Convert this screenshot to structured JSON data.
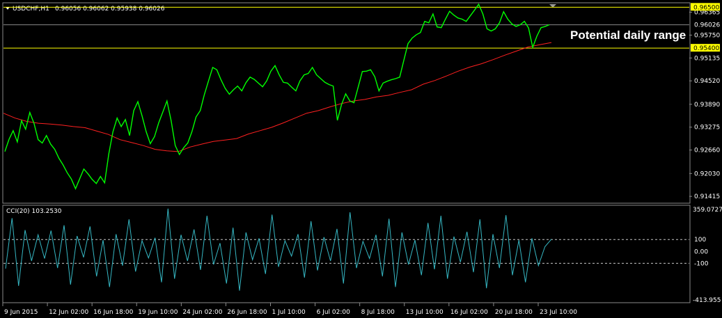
{
  "header": {
    "symbol": "USDCHF,H1",
    "ohlc": "0.96056 0.96062 0.95938 0.96026"
  },
  "annotation": "Potential daily range",
  "indicator": {
    "title": "CCI(20) 103.2530",
    "max_label": "359.0727",
    "min_label": "-413.955",
    "levels": [
      "100",
      "0.00",
      "-100"
    ]
  },
  "colors": {
    "background": "#000000",
    "price": "#00ff00",
    "moving_average": "#ff2020",
    "cci": "#36b8c4",
    "range_tag": "#ffff00"
  },
  "chart_data": [
    {
      "type": "line",
      "series": [
        {
          "values": [
            0.9262,
            0.9295,
            0.9318,
            0.9288,
            0.9345,
            0.9322,
            0.9367,
            0.9338,
            0.9294,
            0.9285,
            0.9305,
            0.9282,
            0.9268,
            0.9244,
            0.9226,
            0.9205,
            0.9188,
            0.9162,
            0.9189,
            0.9215,
            0.9202,
            0.9187,
            0.9176,
            0.9195,
            0.9178,
            0.9255,
            0.9315,
            0.9352,
            0.9329,
            0.9348,
            0.9305,
            0.9372,
            0.9396,
            0.9358,
            0.9315,
            0.9283,
            0.9302,
            0.9339,
            0.9368,
            0.9398,
            0.9345,
            0.9278,
            0.9254,
            0.9272,
            0.9285,
            0.9315,
            0.9355,
            0.9372,
            0.9415,
            0.9452,
            0.9488,
            0.9482,
            0.9455,
            0.9432,
            0.9416,
            0.9428,
            0.9438,
            0.9425,
            0.9447,
            0.9462,
            0.9456,
            0.9446,
            0.9436,
            0.9452,
            0.9478,
            0.9493,
            0.9468,
            0.9448,
            0.9446,
            0.9435,
            0.9425,
            0.9452,
            0.9468,
            0.9472,
            0.9488,
            0.9468,
            0.9458,
            0.9448,
            0.9442,
            0.9438,
            0.9346,
            0.9388,
            0.9417,
            0.9398,
            0.9393,
            0.9435,
            0.9477,
            0.9478,
            0.9482,
            0.9463,
            0.9425,
            0.9446,
            0.9451,
            0.9455,
            0.9458,
            0.9462,
            0.9508,
            0.9552,
            0.9567,
            0.9576,
            0.9582,
            0.9612,
            0.9608,
            0.9632,
            0.9597,
            0.9595,
            0.9618,
            0.9639,
            0.9629,
            0.9621,
            0.9618,
            0.9612,
            0.9627,
            0.9642,
            0.9658,
            0.9632,
            0.9592,
            0.9586,
            0.9592,
            0.9608,
            0.9638,
            0.9618,
            0.9605,
            0.9598,
            0.9603,
            0.9612,
            0.9594,
            0.9542,
            0.9572,
            0.9595,
            0.9598,
            0.9603
          ]
        },
        {
          "values": [
            0.9365,
            0.9352,
            0.9343,
            0.9338,
            0.9336,
            0.9333,
            0.9329,
            0.9326,
            0.9317,
            0.9308,
            0.9294,
            0.9286,
            0.9278,
            0.9268,
            0.9264,
            0.9262,
            0.9274,
            0.9282,
            0.9289,
            0.9293,
            0.9297,
            0.9309,
            0.9318,
            0.9327,
            0.9339,
            0.9352,
            0.9365,
            0.9372,
            0.9382,
            0.9391,
            0.9398,
            0.9402,
            0.9409,
            0.9413,
            0.9421,
            0.9428,
            0.9443,
            0.9453,
            0.9465,
            0.9478,
            0.9489,
            0.9498,
            0.9509,
            0.9521,
            0.9532,
            0.9543,
            0.9549,
            0.9555
          ]
        }
      ],
      "ylim": [
        0.9125,
        0.966
      ],
      "y_ticks": [
        "0.96365",
        "0.95750",
        "0.95135",
        "0.94520",
        "0.93890",
        "0.93275",
        "0.92660",
        "0.92030",
        "0.91415"
      ],
      "hlines": [
        {
          "value": 0.965,
          "label": "0.96500"
        },
        {
          "value": 0.96026,
          "label": "0.96026"
        },
        {
          "value": 0.954,
          "label": "0.95400"
        }
      ],
      "x_ticks": [
        "9 Jun 2015",
        "12 Jun 02:00",
        "16 Jun 18:00",
        "19 Jun 10:00",
        "24 Jun 02:00",
        "26 Jun 18:00",
        "1 Jul 10:00",
        "6 Jul 02:00",
        "8 Jul 18:00",
        "13 Jul 10:00",
        "16 Jul 02:00",
        "20 Jul 18:00",
        "23 Jul 10:00"
      ]
    },
    {
      "type": "line",
      "series": [
        {
          "values": [
            -145,
            280,
            -290,
            180,
            -80,
            140,
            -60,
            175,
            -140,
            220,
            -280,
            130,
            -50,
            210,
            -210,
            95,
            -300,
            145,
            -120,
            270,
            -170,
            90,
            -55,
            115,
            -260,
            360,
            -230,
            140,
            -80,
            185,
            -155,
            300,
            -110,
            70,
            -270,
            200,
            -330,
            160,
            -70,
            110,
            -190,
            310,
            -130,
            90,
            -40,
            145,
            -220,
            255,
            -160,
            120,
            -80,
            190,
            -270,
            330,
            -140,
            85,
            -60,
            140,
            -210,
            275,
            -300,
            160,
            -110,
            95,
            -200,
            240,
            -150,
            300,
            -230,
            125,
            -90,
            165,
            -175,
            270,
            -310,
            145,
            -140,
            305,
            -200,
            95,
            -260,
            110,
            -120,
            40,
            103
          ]
        }
      ],
      "ylim": [
        -414,
        359
      ],
      "levels": [
        100,
        0,
        -100
      ]
    }
  ]
}
